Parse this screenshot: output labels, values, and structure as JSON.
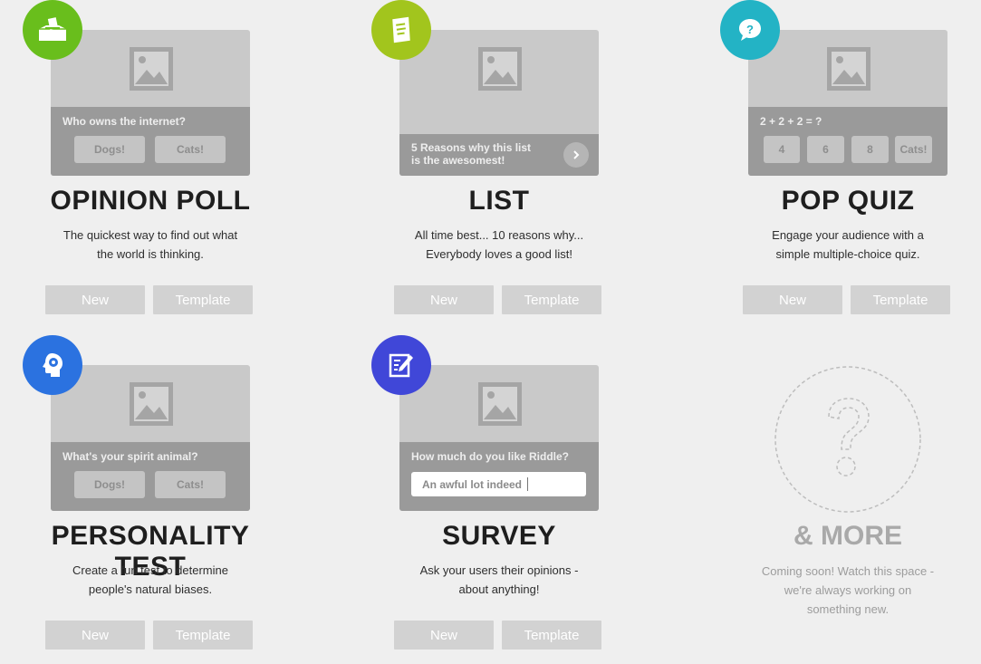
{
  "cards": [
    {
      "title": "OPINION POLL",
      "desc_lines": [
        "The quickest way to find out what",
        "the world is thinking."
      ],
      "preview": {
        "question": "Who owns the internet?",
        "options": [
          "Dogs!",
          "Cats!"
        ]
      },
      "badge_icon": "ballot-box-icon",
      "badge_color": "#69be1c",
      "new_label": "New",
      "template_label": "Template"
    },
    {
      "title": "LIST",
      "desc_lines": [
        "All time best... 10 reasons why...",
        "Everybody loves a good list!"
      ],
      "preview": {
        "question_lines": [
          "5 Reasons why this list",
          "is the awesomest!"
        ]
      },
      "badge_icon": "list-scroll-icon",
      "badge_color": "#a2c51d",
      "new_label": "New",
      "template_label": "Template"
    },
    {
      "title": "POP QUIZ",
      "desc_lines": [
        "Engage your audience with a",
        "simple multiple-choice quiz."
      ],
      "preview": {
        "question": "2 + 2 + 2 = ?",
        "options": [
          "4",
          "6",
          "8",
          "Cats!"
        ]
      },
      "badge_icon": "speech-question-icon",
      "badge_color": "#23b3c5",
      "new_label": "New",
      "template_label": "Template"
    },
    {
      "title": "PERSONALITY TEST",
      "desc_lines": [
        "Create a fun test to determine",
        "people's natural biases."
      ],
      "preview": {
        "question": "What's your spirit animal?",
        "options": [
          "Dogs!",
          "Cats!"
        ]
      },
      "badge_icon": "head-gear-icon",
      "badge_color": "#2b72e0",
      "new_label": "New",
      "template_label": "Template"
    },
    {
      "title": "SURVEY",
      "desc_lines": [
        "Ask your users their opinions -",
        "about anything!"
      ],
      "preview": {
        "question": "How much do you like Riddle?",
        "answer": "An awful lot indeed"
      },
      "badge_icon": "form-pencil-icon",
      "badge_color": "#4047d8",
      "new_label": "New",
      "template_label": "Template"
    }
  ],
  "more": {
    "title": "& MORE",
    "desc_lines": [
      "Coming soon! Watch this space -",
      "we're always working on",
      "something new."
    ],
    "icon": "question-mark-icon"
  }
}
